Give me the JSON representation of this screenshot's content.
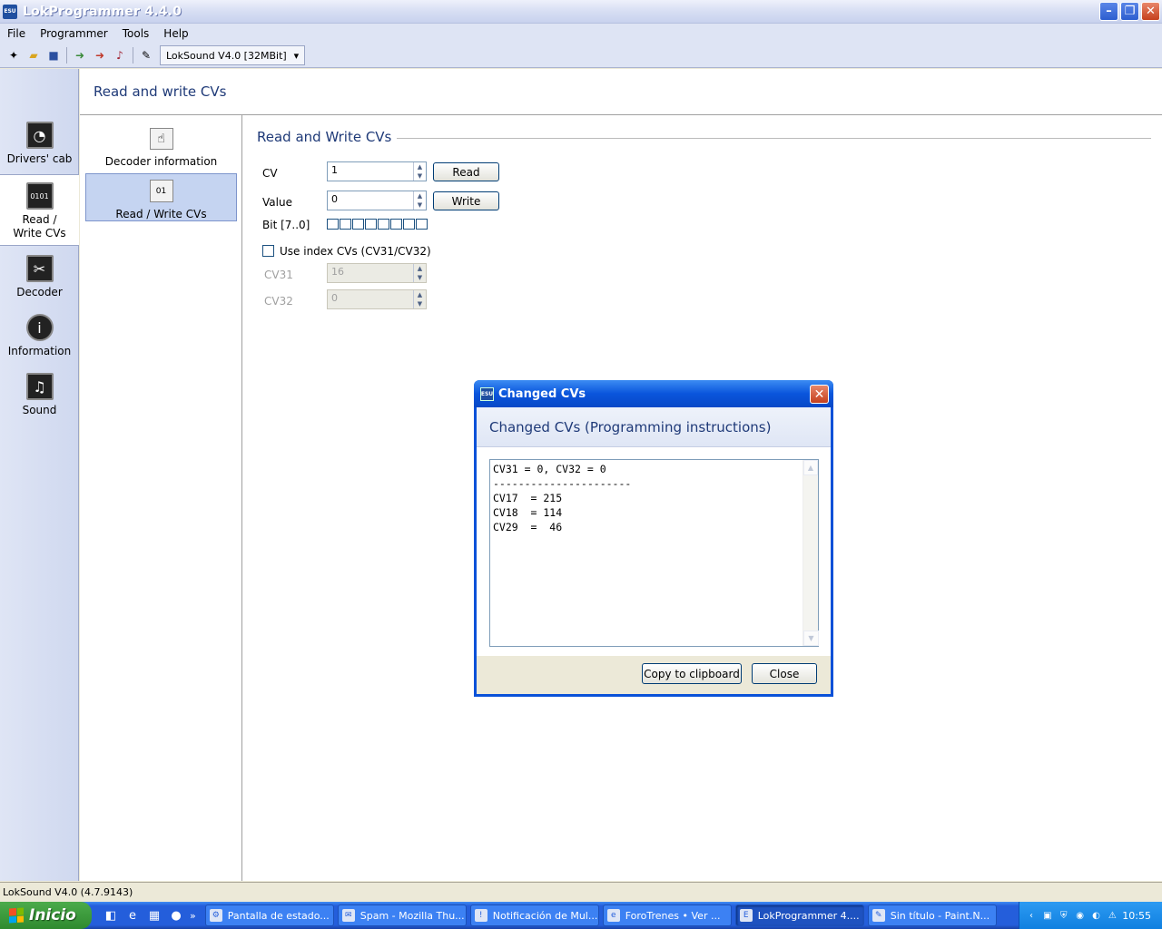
{
  "window": {
    "title": "LokProgrammer 4.4.0",
    "icon_text": "ESU"
  },
  "menu": [
    "File",
    "Programmer",
    "Tools",
    "Help"
  ],
  "toolbar": {
    "decoder_select": "LokSound V4.0 [32MBit]"
  },
  "leftnav": [
    {
      "label": "Drivers' cab",
      "icon": "cab-icon"
    },
    {
      "label": "Read / Write CVs",
      "icon": "binary-icon"
    },
    {
      "label": "Decoder",
      "icon": "wrench-icon"
    },
    {
      "label": "Information",
      "icon": "info-icon"
    },
    {
      "label": "Sound",
      "icon": "music-icon"
    }
  ],
  "content": {
    "header": "Read and write CVs"
  },
  "subnav": [
    {
      "label": "Decoder information"
    },
    {
      "label": "Read / Write CVs"
    }
  ],
  "form": {
    "group_title": "Read and Write CVs",
    "cv_label": "CV",
    "cv_value": "1",
    "read_label": "Read",
    "value_label": "Value",
    "value_value": "0",
    "write_label": "Write",
    "bit_label": "Bit [7..0]",
    "use_index_label": "Use index CVs (CV31/CV32)",
    "cv31_label": "CV31",
    "cv31_value": "16",
    "cv32_label": "CV32",
    "cv32_value": "0"
  },
  "dialog": {
    "title": "Changed CVs",
    "icon_text": "ESU",
    "heading": "Changed CVs (Programming instructions)",
    "text": "CV31 = 0, CV32 = 0\n----------------------\nCV17  = 215\nCV18  = 114\nCV29  =  46",
    "copy_label": "Copy to clipboard",
    "close_label": "Close"
  },
  "status": {
    "text": "LokSound V4.0 (4.7.9143)"
  },
  "taskbar": {
    "start_label": "Inicio",
    "tasks": [
      "Pantalla de estado...",
      "Spam - Mozilla Thu...",
      "Notificación de Mul...",
      "ForoTrenes • Ver ...",
      "LokProgrammer 4....",
      "Sin título - Paint.N..."
    ],
    "clock": "10:55"
  }
}
